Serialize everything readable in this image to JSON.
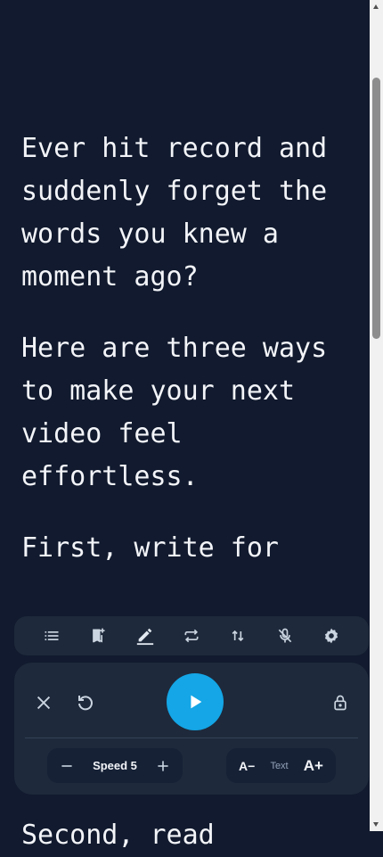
{
  "script": {
    "paragraphs": [
      "Ever hit record and suddenly forget the words you knew a moment ago?",
      "Here are three ways to make your next video feel effortless.",
      "First, write for"
    ],
    "tail": "Second, read"
  },
  "toolbar": {
    "tools": [
      "list-icon",
      "bookmark-add-icon",
      "edit-icon",
      "loop-icon",
      "swap-vertical-icon",
      "mic-off-icon",
      "settings-icon"
    ]
  },
  "controls": {
    "speed_label": "Speed 5",
    "font_decrease": "A−",
    "font_label": "Text",
    "font_increase": "A+"
  },
  "colors": {
    "background": "#111a2e",
    "panel": "#1e293b",
    "accent": "#14a6e6",
    "text": "#f2f4f8"
  }
}
